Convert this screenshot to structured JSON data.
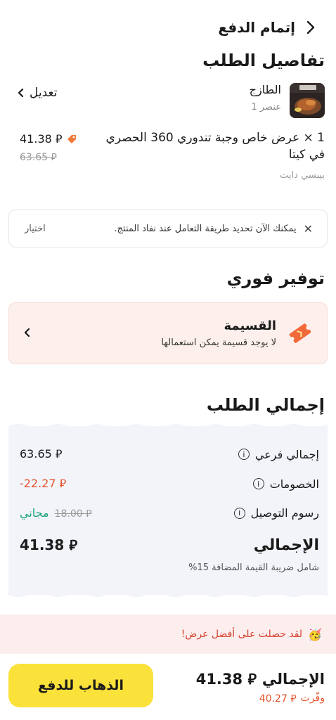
{
  "header": {
    "title": "إتمام الدفع"
  },
  "order_details": {
    "title": "تفاصيل الطلب",
    "store_name": "الطازج",
    "item_count": "عنصر 1",
    "edit_label": "تعديل",
    "item_name": "1 × عرض خاص وجبة تندوري 360 الحصري في كيتا",
    "item_option": "بيبسي دايت",
    "price": "41.38 ⃁",
    "old_price": "63.65 ⃁"
  },
  "notice": {
    "text": "يمكنك الآن تحديد طريقة التعامل عند نفاد المنتج.",
    "action": "اختيار"
  },
  "instant_savings": {
    "title": "توفير فوري",
    "coupon_title": "القسيمة",
    "coupon_subtitle": "لا يوجد قسيمة يمكن استعمالها"
  },
  "summary": {
    "title": "إجمالي الطلب",
    "subtotal_label": "إجمالي فرعي",
    "subtotal_value": "63.65 ⃁",
    "discounts_label": "الخصومات",
    "discounts_value": "-22.27 ⃁",
    "delivery_label": "رسوم التوصيل",
    "delivery_old": "18.00 ⃁",
    "delivery_value": "مجاني",
    "total_label": "الإجمالي",
    "total_value": "41.38 ⃁",
    "vat_note": "شامل ضريبة القيمة المضافة 15%"
  },
  "best_offer": {
    "emoji": "🥳",
    "text": "لقد حصلت على أفضل عرض!"
  },
  "footer": {
    "total_label": "الإجمالي",
    "total_value": "41.38 ⃁",
    "saved_label": "وفّرت",
    "saved_value": "40.27 ⃁",
    "pay_button": "الذهاب للدفع"
  },
  "colors": {
    "accent": "#fbe23a",
    "discount": "#e5532d",
    "free": "#1aa37a"
  }
}
